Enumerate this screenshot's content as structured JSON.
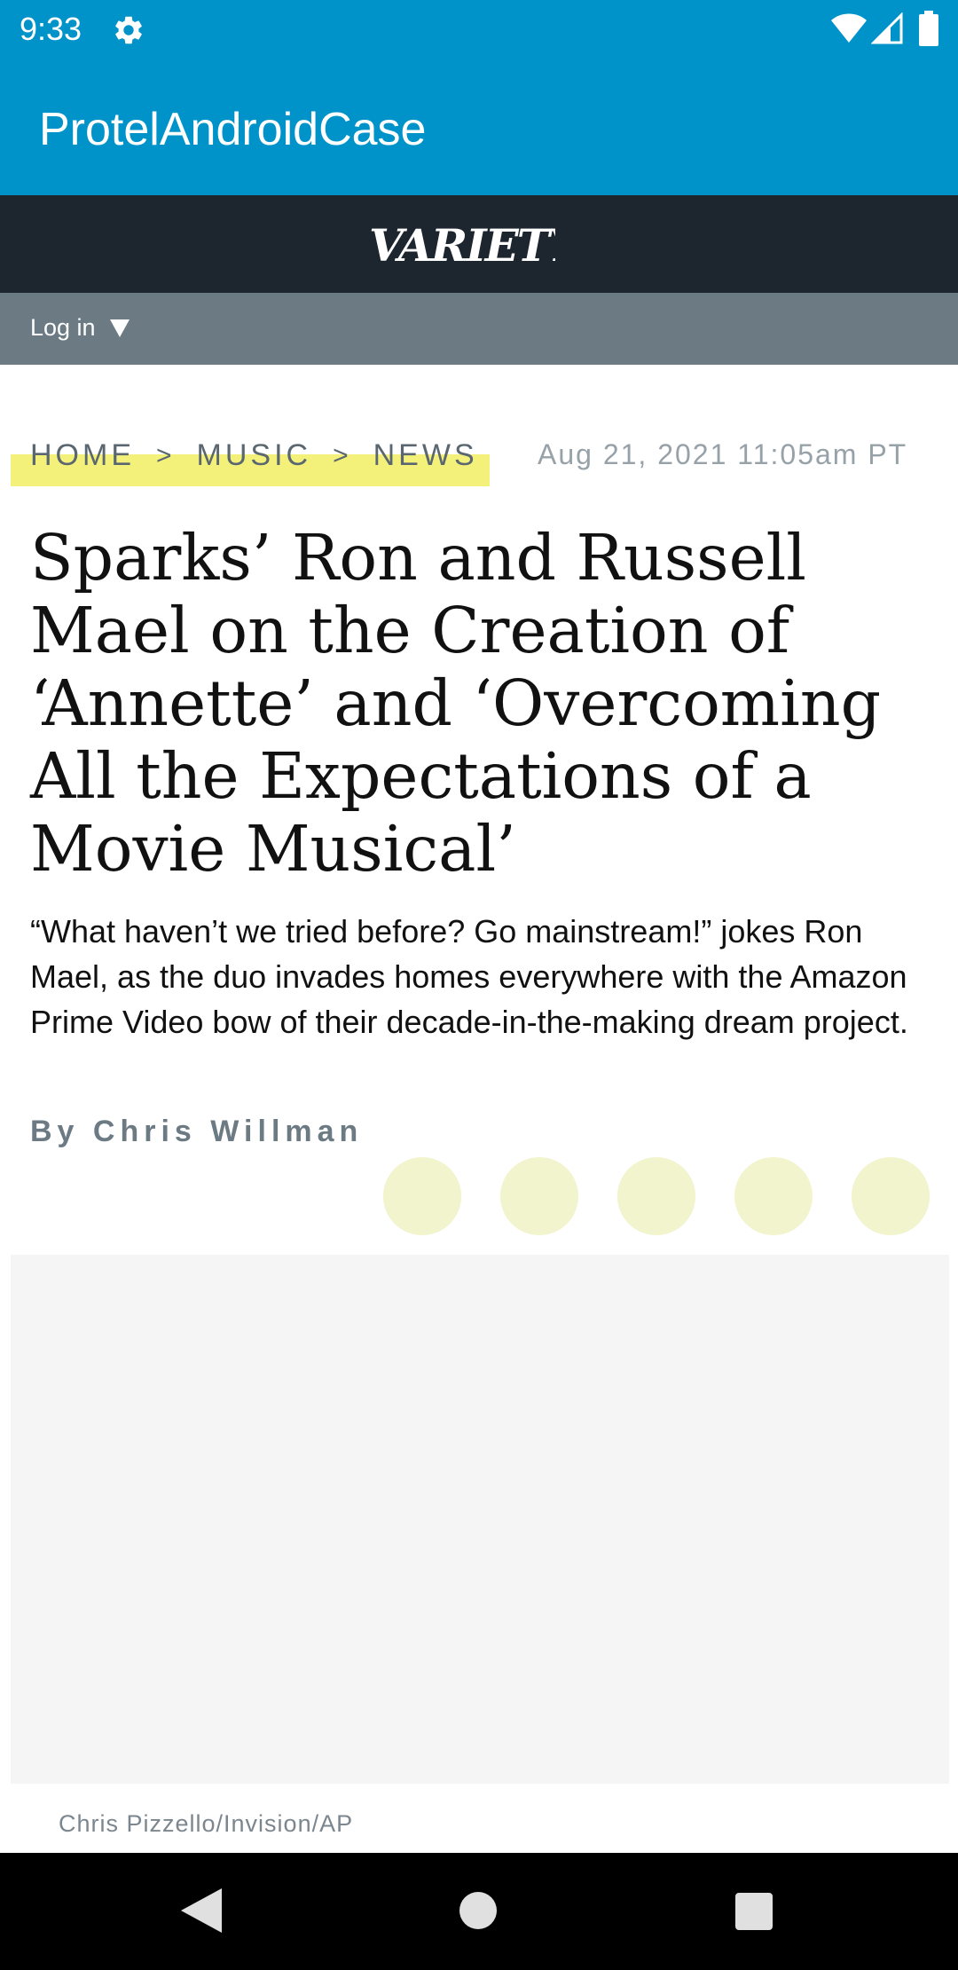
{
  "status_bar": {
    "time": "9:33",
    "icons": [
      "gear-icon",
      "wifi-icon",
      "signal-icon",
      "battery-icon"
    ]
  },
  "app_bar": {
    "title": "ProtelAndroidCase",
    "color": "#0093c9"
  },
  "site_header": {
    "logo_text": "VARIETY",
    "background": "#1d262f"
  },
  "login_bar": {
    "login_label": "Log in",
    "caret_icon": "caret-down-icon",
    "background": "#6b7a83"
  },
  "article": {
    "breadcrumb": {
      "items": [
        "HOME",
        "MUSIC",
        "NEWS"
      ],
      "separator": ">",
      "highlight_color": "#f4f17a"
    },
    "timestamp": "Aug 21, 2021 11:05am PT",
    "headline_lines": [
      "Sparks’ Ron and Russell",
      "Mael on the Creation of",
      "‘Annette’ and ‘Overcoming",
      "All the Expectations of a",
      "Movie Musical’"
    ],
    "dek": "“What haven’t we tried before? Go mainstream!” jokes Ron Mael, as the duo invades homes everywhere with the Amazon Prime Video bow of their decade-in-the-making dream project.",
    "byline": "By Chris Willman",
    "share_button_count": 5,
    "share_button_color": "#f1f4cd",
    "photo_credit": "Chris Pizzello/Invision/AP"
  },
  "nav_bar": {
    "icons": [
      "back-icon",
      "home-icon",
      "recents-icon"
    ]
  }
}
